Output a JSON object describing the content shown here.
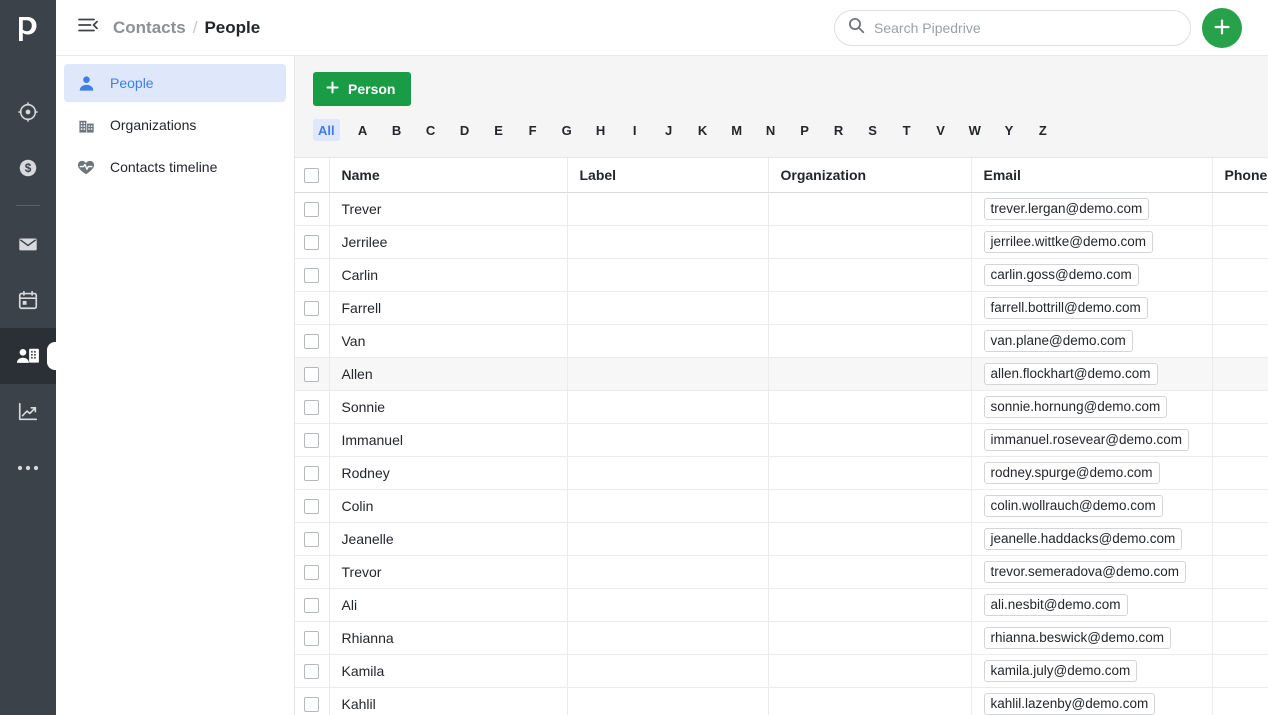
{
  "app": {
    "logo_icon": "pipedrive-p-logo",
    "accent_green": "#27a24a",
    "accent_blue": "#3e7ee6",
    "rail_bg": "#3c4249"
  },
  "rail": {
    "items": [
      {
        "icon": "leads-target-icon",
        "name": "leads",
        "active": false
      },
      {
        "icon": "deals-dollar-icon",
        "name": "deals",
        "active": false
      },
      {
        "icon": "mail-envelope-icon",
        "name": "mail",
        "active": false
      },
      {
        "icon": "calendar-icon",
        "name": "activities",
        "active": false
      },
      {
        "icon": "contacts-person-card-icon",
        "name": "contacts",
        "active": true
      },
      {
        "icon": "insights-trending-up-icon",
        "name": "insights",
        "active": false
      },
      {
        "icon": "more-ellipsis-icon",
        "name": "more",
        "active": false
      }
    ]
  },
  "topbar": {
    "collapse_icon": "collapse-sidebar-icon",
    "breadcrumb": {
      "parent": "Contacts",
      "separator": "/",
      "current": "People"
    },
    "search": {
      "icon": "search-icon",
      "placeholder": "Search Pipedrive",
      "value": ""
    },
    "add_button": {
      "icon": "plus-icon",
      "label": ""
    }
  },
  "subnav": {
    "items": [
      {
        "label": "People",
        "icon": "person-icon",
        "active": true
      },
      {
        "label": "Organizations",
        "icon": "building-icon",
        "active": false
      },
      {
        "label": "Contacts timeline",
        "icon": "heart-pulse-icon",
        "active": false
      }
    ]
  },
  "main": {
    "add_person_button": {
      "label": "Person",
      "icon": "plus-icon"
    },
    "alphabet_filter": {
      "selected": "All",
      "items": [
        "All",
        "A",
        "B",
        "C",
        "D",
        "E",
        "F",
        "G",
        "H",
        "I",
        "J",
        "K",
        "M",
        "N",
        "P",
        "R",
        "S",
        "T",
        "V",
        "W",
        "Y",
        "Z"
      ]
    },
    "table": {
      "select_all_checkbox": false,
      "columns": [
        "Name",
        "Label",
        "Organization",
        "Email",
        "Phone"
      ],
      "rows": [
        {
          "name": "Trever",
          "label": "",
          "organization": "",
          "email": "trever.lergan@demo.com",
          "phone": "",
          "checked": false,
          "hover": false
        },
        {
          "name": "Jerrilee",
          "label": "",
          "organization": "",
          "email": "jerrilee.wittke@demo.com",
          "phone": "",
          "checked": false,
          "hover": false
        },
        {
          "name": "Carlin",
          "label": "",
          "organization": "",
          "email": "carlin.goss@demo.com",
          "phone": "",
          "checked": false,
          "hover": false
        },
        {
          "name": "Farrell",
          "label": "",
          "organization": "",
          "email": "farrell.bottrill@demo.com",
          "phone": "",
          "checked": false,
          "hover": false
        },
        {
          "name": "Van",
          "label": "",
          "organization": "",
          "email": "van.plane@demo.com",
          "phone": "",
          "checked": false,
          "hover": false
        },
        {
          "name": "Allen",
          "label": "",
          "organization": "",
          "email": "allen.flockhart@demo.com",
          "phone": "",
          "checked": false,
          "hover": true
        },
        {
          "name": "Sonnie",
          "label": "",
          "organization": "",
          "email": "sonnie.hornung@demo.com",
          "phone": "",
          "checked": false,
          "hover": false
        },
        {
          "name": "Immanuel",
          "label": "",
          "organization": "",
          "email": "immanuel.rosevear@demo.com",
          "phone": "",
          "checked": false,
          "hover": false
        },
        {
          "name": "Rodney",
          "label": "",
          "organization": "",
          "email": "rodney.spurge@demo.com",
          "phone": "",
          "checked": false,
          "hover": false
        },
        {
          "name": "Colin",
          "label": "",
          "organization": "",
          "email": "colin.wollrauch@demo.com",
          "phone": "",
          "checked": false,
          "hover": false
        },
        {
          "name": "Jeanelle",
          "label": "",
          "organization": "",
          "email": "jeanelle.haddacks@demo.com",
          "phone": "",
          "checked": false,
          "hover": false
        },
        {
          "name": "Trevor",
          "label": "",
          "organization": "",
          "email": "trevor.semeradova@demo.com",
          "phone": "",
          "checked": false,
          "hover": false
        },
        {
          "name": "Ali",
          "label": "",
          "organization": "",
          "email": "ali.nesbit@demo.com",
          "phone": "",
          "checked": false,
          "hover": false
        },
        {
          "name": "Rhianna",
          "label": "",
          "organization": "",
          "email": "rhianna.beswick@demo.com",
          "phone": "",
          "checked": false,
          "hover": false
        },
        {
          "name": "Kamila",
          "label": "",
          "organization": "",
          "email": "kamila.july@demo.com",
          "phone": "",
          "checked": false,
          "hover": false
        },
        {
          "name": "Kahlil",
          "label": "",
          "organization": "",
          "email": "kahlil.lazenby@demo.com",
          "phone": "",
          "checked": false,
          "hover": false
        }
      ]
    }
  }
}
